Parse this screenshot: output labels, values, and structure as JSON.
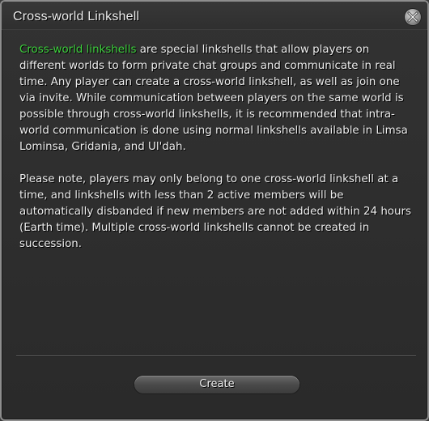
{
  "window": {
    "title": "Cross-world Linkshell",
    "close_icon": "close-icon"
  },
  "body": {
    "paragraph1": {
      "highlight": "Cross-world linkshells",
      "rest": " are special linkshells that allow players on different worlds to form private chat groups and communicate in real time. Any player can create a cross-world linkshell, as well as join one via invite. While communication between players on the same world is possible through cross-world linkshells, it is recommended that intra-world communication is done using normal linkshells available in Limsa Lominsa, Gridania, and Ul'dah."
    },
    "paragraph2": "Please note, players may only belong to one cross-world linkshell at a time, and linkshells with less than 2 active members will be automatically disbanded if new members are not added within 24 hours (Earth time). Multiple cross-world linkshells cannot be created in succession."
  },
  "footer": {
    "create_label": "Create"
  },
  "colors": {
    "highlight": "#3ccf3c",
    "text": "#ededed",
    "background": "#2e2e2e"
  }
}
